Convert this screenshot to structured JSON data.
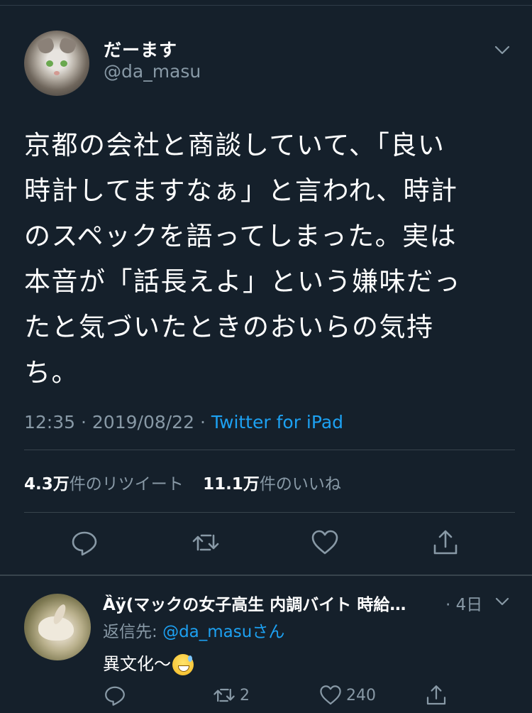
{
  "main_tweet": {
    "display_name": "だーます",
    "handle": "@da_masu",
    "text": "京都の会社と商談していて、「良い\n時計してますなぁ」と言われ、時計\nのスペックを語ってしまった。実は\n本音が「話長えよ」という嫌味だっ\nたと気づいたときのおいらの気持\nち。",
    "time": "12:35",
    "date": "2019/08/22",
    "source": "Twitter for iPad",
    "retweet_count": "4.3万",
    "retweet_label": "件のリツイート",
    "like_count": "11.1万",
    "like_label": "件のいいね"
  },
  "reply": {
    "display_name": "Ȁÿ(マックの女子高生 内調バイト 時給…",
    "time": "4日",
    "reply_prefix": "返信先: ",
    "reply_handle": "@da_masu",
    "reply_suffix": "さん",
    "text": "異文化〜",
    "retweets": "2",
    "likes": "240"
  },
  "icons": [
    "chevron-down-icon",
    "reply-icon",
    "retweet-icon",
    "like-icon",
    "share-icon",
    "grinning-sweat-emoji"
  ],
  "colors": {
    "background": "#15202b",
    "text": "#ffffff",
    "muted": "#8899a6",
    "link": "#1da1f2",
    "divider": "#38444d"
  }
}
